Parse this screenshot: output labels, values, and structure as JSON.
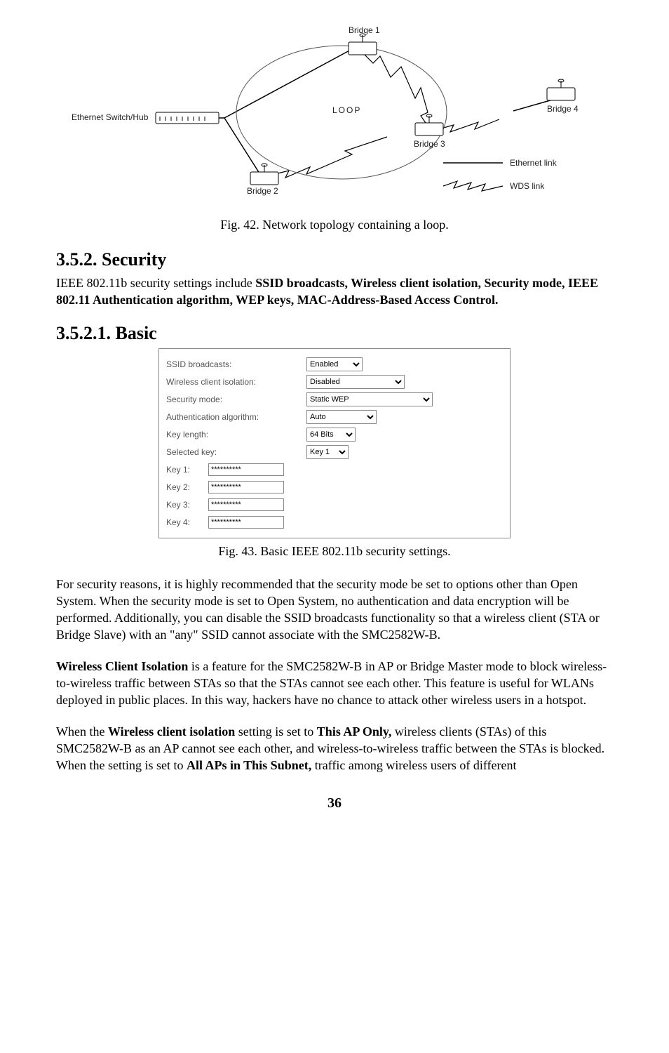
{
  "diagram": {
    "labels": {
      "bridge1": "Bridge 1",
      "bridge2": "Bridge 2",
      "bridge3": "Bridge 3",
      "bridge4": "Bridge 4",
      "loop": "LOOP",
      "switch": "Ethernet Switch/Hub",
      "ethernet_link": "Ethernet link",
      "wds_link": "WDS link"
    },
    "caption": "Fig. 42. Network topology containing a loop."
  },
  "section1": {
    "heading": "3.5.2. Security",
    "text_prefix": "IEEE 802.11b security settings include ",
    "text_bold": "SSID broadcasts, Wireless client isolation, Security mode, IEEE 802.11 Authentication algorithm, WEP keys, MAC-Address-Based Access Control."
  },
  "section2": {
    "heading": "3.5.2.1. Basic"
  },
  "settings": {
    "ssid_label": "SSID broadcasts:",
    "ssid_value": "Enabled",
    "wci_label": "Wireless client isolation:",
    "wci_value": "Disabled",
    "secmode_label": "Security mode:",
    "secmode_value": "Static WEP",
    "auth_label": "Authentication algorithm:",
    "auth_value": "Auto",
    "keylen_label": "Key length:",
    "keylen_value": "64 Bits",
    "selkey_label": "Selected key:",
    "selkey_value": "Key 1",
    "key1_label": "Key 1:",
    "key1_value": "**********",
    "key2_label": "Key 2:",
    "key2_value": "**********",
    "key3_label": "Key 3:",
    "key3_value": "**********",
    "key4_label": "Key 4:",
    "key4_value": "**********",
    "caption": "Fig. 43. Basic IEEE 802.11b security settings."
  },
  "para1": "For security reasons, it is highly recommended that the security mode be set to options other than Open System. When the security mode is set to Open System, no authentication and data encryption will be performed. Additionally, you can disable the SSID broadcasts functionality so that a wireless client (STA or Bridge Slave) with an \"any\" SSID cannot associate with the SMC2582W-B.",
  "para2": {
    "bold": "Wireless Client Isolation",
    "rest": "   is a feature for the SMC2582W-B in AP or Bridge Master mode to block wireless-to-wireless traffic between STAs so that the STAs cannot see each other. This feature is useful for WLANs deployed in public places. In this way, hackers have no chance to attack other wireless users in a hotspot."
  },
  "para3": {
    "t1": "When the ",
    "b1": "Wireless client isolation",
    "t2": " setting is set to ",
    "b2": "This AP Only,",
    "t3": " wireless clients (STAs) of this SMC2582W-B as an AP cannot see each other, and wireless-to-wireless traffic between the STAs is blocked. When the setting is set to ",
    "b3": "All APs in This Subnet,",
    "t4": " traffic among wireless users of different"
  },
  "page_number": "36"
}
